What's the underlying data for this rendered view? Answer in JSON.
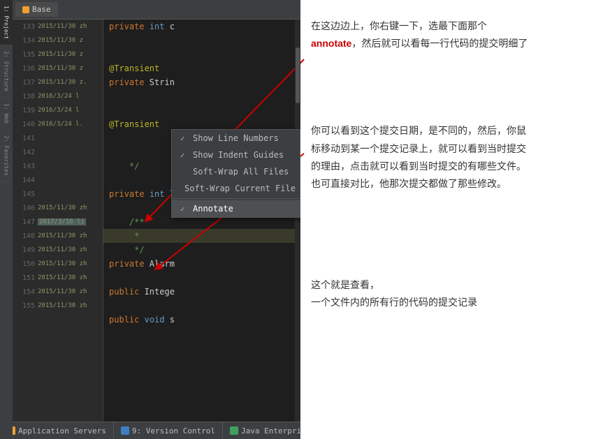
{
  "tabs": {
    "active_tab": "Base"
  },
  "gutter_rows": [
    {
      "line": "133",
      "commit": "2015/11/30 zh",
      "highlight": false
    },
    {
      "line": "134",
      "commit": "2015/11/30 z",
      "highlight": false
    },
    {
      "line": "135",
      "commit": "2015/11/30 z",
      "highlight": false
    },
    {
      "line": "136",
      "commit": "2015/11/30 z",
      "highlight": false
    },
    {
      "line": "137",
      "commit": "2015/11/30 z.",
      "highlight": false
    },
    {
      "line": "138",
      "commit": "2016/3/24  l",
      "highlight": false
    },
    {
      "line": "139",
      "commit": "2016/3/24  l",
      "highlight": false
    },
    {
      "line": "140",
      "commit": "2016/3/24  l.",
      "highlight": false
    },
    {
      "line": "141",
      "commit": "",
      "highlight": false
    },
    {
      "line": "142",
      "commit": "",
      "highlight": false
    },
    {
      "line": "143",
      "commit": "",
      "highlight": false
    },
    {
      "line": "144",
      "commit": "",
      "highlight": false
    },
    {
      "line": "145",
      "commit": "",
      "highlight": false
    },
    {
      "line": "146",
      "commit": "2015/11/30 zh",
      "highlight": false
    },
    {
      "line": "147",
      "commit": "2017/3/16  li",
      "highlight": true
    },
    {
      "line": "148",
      "commit": "2015/11/30 zh",
      "highlight": false
    },
    {
      "line": "149",
      "commit": "2015/11/30 zh",
      "highlight": false
    },
    {
      "line": "150",
      "commit": "2015/11/30 zh",
      "highlight": false
    },
    {
      "line": "151",
      "commit": "2015/11/30 zh",
      "highlight": false
    },
    {
      "line": "154",
      "commit": "2015/11/30 zh",
      "highlight": false
    },
    {
      "line": "155",
      "commit": "2015/11/30 zh",
      "highlight": false
    }
  ],
  "code_rows": [
    {
      "text": "private int c",
      "type": "kw_private"
    },
    {
      "text": "",
      "type": "empty"
    },
    {
      "text": "",
      "type": "empty"
    },
    {
      "text": "@Transient",
      "type": "annotation"
    },
    {
      "text": "private Strin",
      "type": "kw_private"
    },
    {
      "text": "",
      "type": "empty"
    },
    {
      "text": "",
      "type": "empty"
    },
    {
      "text": "@Transient",
      "type": "annotation"
    },
    {
      "text": "",
      "type": "empty"
    },
    {
      "text": "",
      "type": "empty"
    },
    {
      "text": "*/",
      "type": "comment"
    },
    {
      "text": "",
      "type": "empty"
    },
    {
      "text": "private int l",
      "type": "kw_private"
    },
    {
      "text": "",
      "type": "empty"
    },
    {
      "text": "/**",
      "type": "comment"
    },
    {
      "text": " *",
      "type": "comment"
    },
    {
      "text": " */",
      "type": "comment"
    },
    {
      "text": "private Alarm",
      "type": "kw_private"
    },
    {
      "text": "",
      "type": "empty"
    },
    {
      "text": "public Intege",
      "type": "kw_public"
    },
    {
      "text": "",
      "type": "empty"
    },
    {
      "text": "public void s",
      "type": "kw_public"
    }
  ],
  "context_menu": {
    "items": [
      {
        "label": "Show Line Numbers",
        "checked": true,
        "separator_after": false
      },
      {
        "label": "Show Indent Guides",
        "checked": true,
        "separator_after": false
      },
      {
        "label": "Soft-Wrap All Files",
        "checked": false,
        "separator_after": false
      },
      {
        "label": "Soft-Wrap Current File",
        "checked": false,
        "separator_after": true
      },
      {
        "label": "Annotate",
        "checked": true,
        "separator_after": false
      }
    ]
  },
  "annotations": [
    {
      "text": "在这边边上，你右键一下，选最下面那个annotate，然后就可以看每一行代码的提交明细了",
      "annotate_word": "annotate"
    },
    {
      "text": "你可以看到这个提交日期，是不同的，然后，你鼠标移动到某一个提交记录上，就可以看到当时提交的理由，点击就可以看到当时提交的有哪些文件。也可直接对比，他那次提交都做了那些修改。"
    },
    {
      "text": "这个就是查看，\n一个文件内的所有行的代码的提交记录"
    }
  ],
  "bottom_tabs": [
    {
      "label": "Application Servers",
      "icon": "orange"
    },
    {
      "label": "9: Version Control",
      "icon": "blue"
    },
    {
      "label": "Java Enterprise",
      "icon": "green"
    }
  ],
  "vtabs": [
    {
      "label": "1: Project"
    },
    {
      "label": "2: Structure"
    },
    {
      "label": "1: Web"
    },
    {
      "label": "2: Favorites"
    }
  ]
}
